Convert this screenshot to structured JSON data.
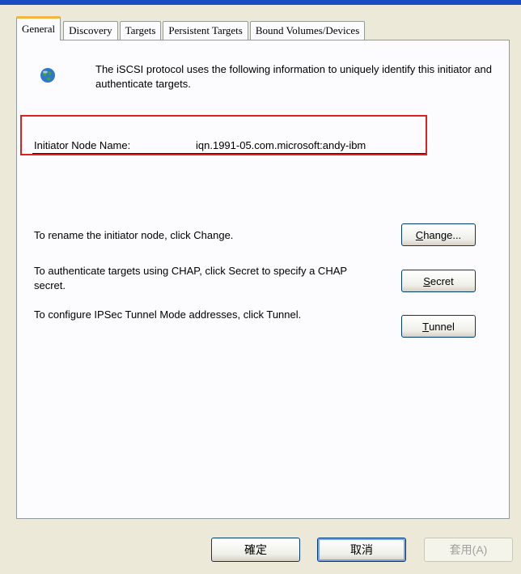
{
  "tabs": [
    {
      "label": "General"
    },
    {
      "label": "Discovery"
    },
    {
      "label": "Targets"
    },
    {
      "label": "Persistent Targets"
    },
    {
      "label": "Bound Volumes/Devices"
    }
  ],
  "active_tab": "General",
  "general": {
    "intro_text": "The iSCSI protocol uses the following information to uniquely identify this initiator and authenticate targets.",
    "node_name_label": "Initiator Node Name:",
    "node_name_value": "iqn.1991-05.com.microsoft:andy-ibm",
    "rename_text": "To rename the initiator node, click Change.",
    "chap_text": "To authenticate targets using CHAP, click Secret to specify a CHAP secret.",
    "ipsec_text": "To configure IPSec Tunnel Mode addresses, click Tunnel.",
    "change_button": {
      "mnemonic": "C",
      "rest": "hange..."
    },
    "secret_button": {
      "mnemonic": "S",
      "rest": "ecret"
    },
    "tunnel_button": {
      "mnemonic": "T",
      "rest": "unnel"
    }
  },
  "dialog_buttons": {
    "ok": "確定",
    "cancel": "取消",
    "apply": "套用(A)"
  },
  "colors": {
    "highlight_border": "#e0201f",
    "active_tab_accent": "#f4b540",
    "title_bar": "#1a4cc2"
  },
  "icons": {
    "intro": "globe-icon"
  }
}
